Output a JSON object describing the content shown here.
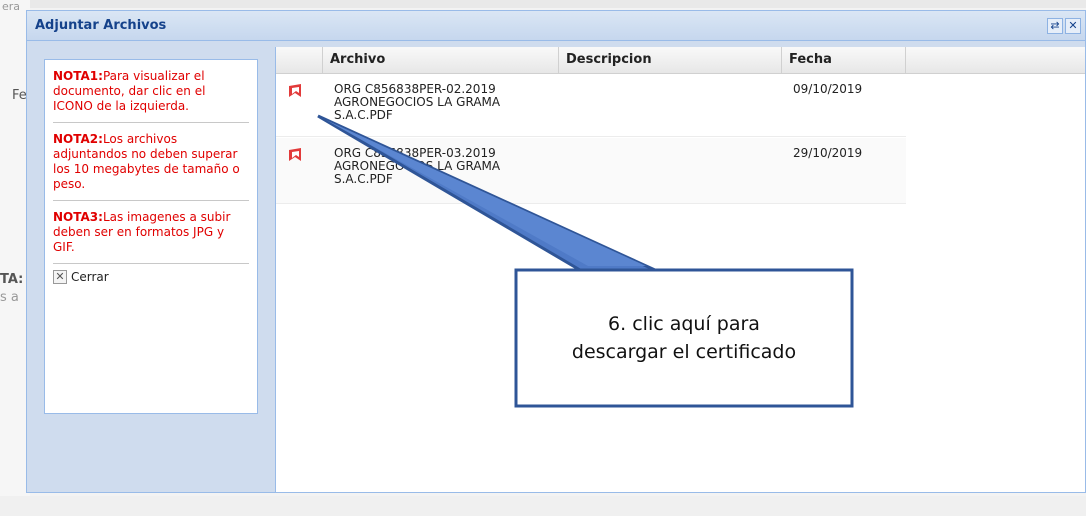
{
  "background": {
    "frag_fe": "Fe",
    "frag_ta": "TA:",
    "frag_sa": "s a",
    "frag_ra": "era"
  },
  "window": {
    "title": "Adjuntar Archivos",
    "tools": [
      "refresh-icon",
      "close-icon"
    ]
  },
  "notes": [
    {
      "label": "NOTA1:",
      "text": "Para visualizar el documento, dar clic en el ICONO de la izquierda."
    },
    {
      "label": "NOTA2:",
      "text": "Los archivos adjuntandos no deben superar los 10 megabytes de tamaño o peso."
    },
    {
      "label": "NOTA3:",
      "text": "Las imagenes a subir deben ser en formatos JPG y GIF."
    }
  ],
  "close_label": "Cerrar",
  "grid": {
    "columns": [
      "Archivo",
      "Descripcion",
      "Fecha"
    ],
    "rows": [
      {
        "archivo": "ORG C856838PER-02.2019 AGRONEGOCIOS LA GRAMA S.A.C.PDF",
        "descripcion": "",
        "fecha": "09/10/2019"
      },
      {
        "archivo": "ORG C856838PER-03.2019 AGRONEGOCIOS LA GRAMA S.A.C.PDF",
        "descripcion": "",
        "fecha": "29/10/2019"
      }
    ]
  },
  "callout": {
    "line1": "6. clic aquí para",
    "line2": "descargar el certificado"
  },
  "colors": {
    "callout_fill": "#4f7ac7",
    "callout_border": "#2f5597",
    "note_red": "#e00000",
    "title_blue": "#15428b"
  }
}
